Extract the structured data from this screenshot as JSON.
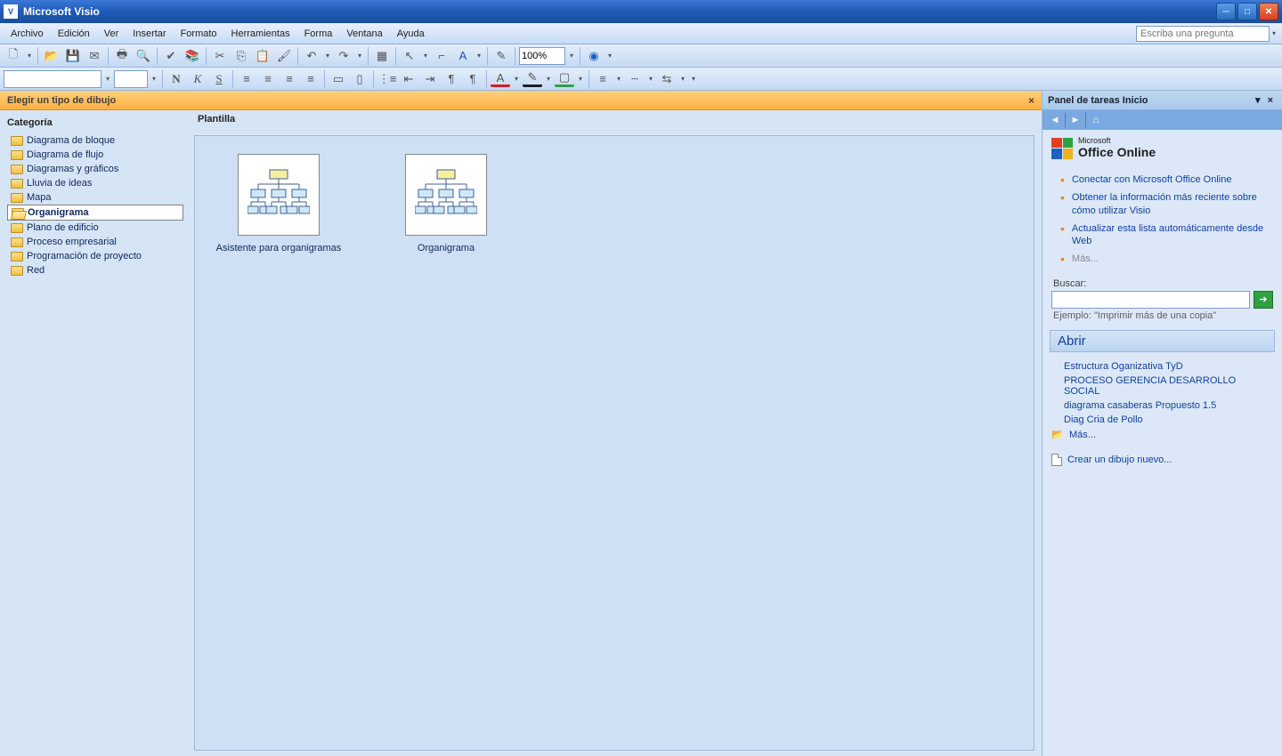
{
  "title": "Microsoft Visio",
  "menu": [
    "Archivo",
    "Edición",
    "Ver",
    "Insertar",
    "Formato",
    "Herramientas",
    "Forma",
    "Ventana",
    "Ayuda"
  ],
  "help_placeholder": "Escriba una pregunta",
  "zoom": "100%",
  "chooser": {
    "title": "Elegir un tipo de dibujo",
    "category_header": "Categoría",
    "template_header": "Plantilla",
    "categories": [
      "Diagrama de bloque",
      "Diagrama de flujo",
      "Diagramas y gráficos",
      "Lluvia de ideas",
      "Mapa",
      "Organigrama",
      "Plano de edificio",
      "Proceso empresarial",
      "Programación de proyecto",
      "Red"
    ],
    "selected_category_index": 5,
    "templates": [
      {
        "label": "Asistente para organigramas"
      },
      {
        "label": "Organigrama"
      }
    ]
  },
  "pane": {
    "title": "Panel de tareas Inicio",
    "office_brand_small": "Microsoft",
    "office_brand": "Office Online",
    "links": [
      "Conectar con Microsoft Office Online",
      "Obtener la información más reciente sobre cómo utilizar Visio",
      "Actualizar esta lista automáticamente desde Web"
    ],
    "more_links": "Más...",
    "search_label": "Buscar:",
    "search_example": "Ejemplo: \"Imprimir más de una copia\"",
    "open_header": "Abrir",
    "recent": [
      "Estructura Oganizativa TyD",
      "PROCESO GERENCIA DESARROLLO SOCIAL",
      "diagrama casaberas Propuesto 1.5",
      "Diag Cria de Pollo"
    ],
    "more_recent": "Más...",
    "new_drawing": "Crear un dibujo nuevo..."
  }
}
